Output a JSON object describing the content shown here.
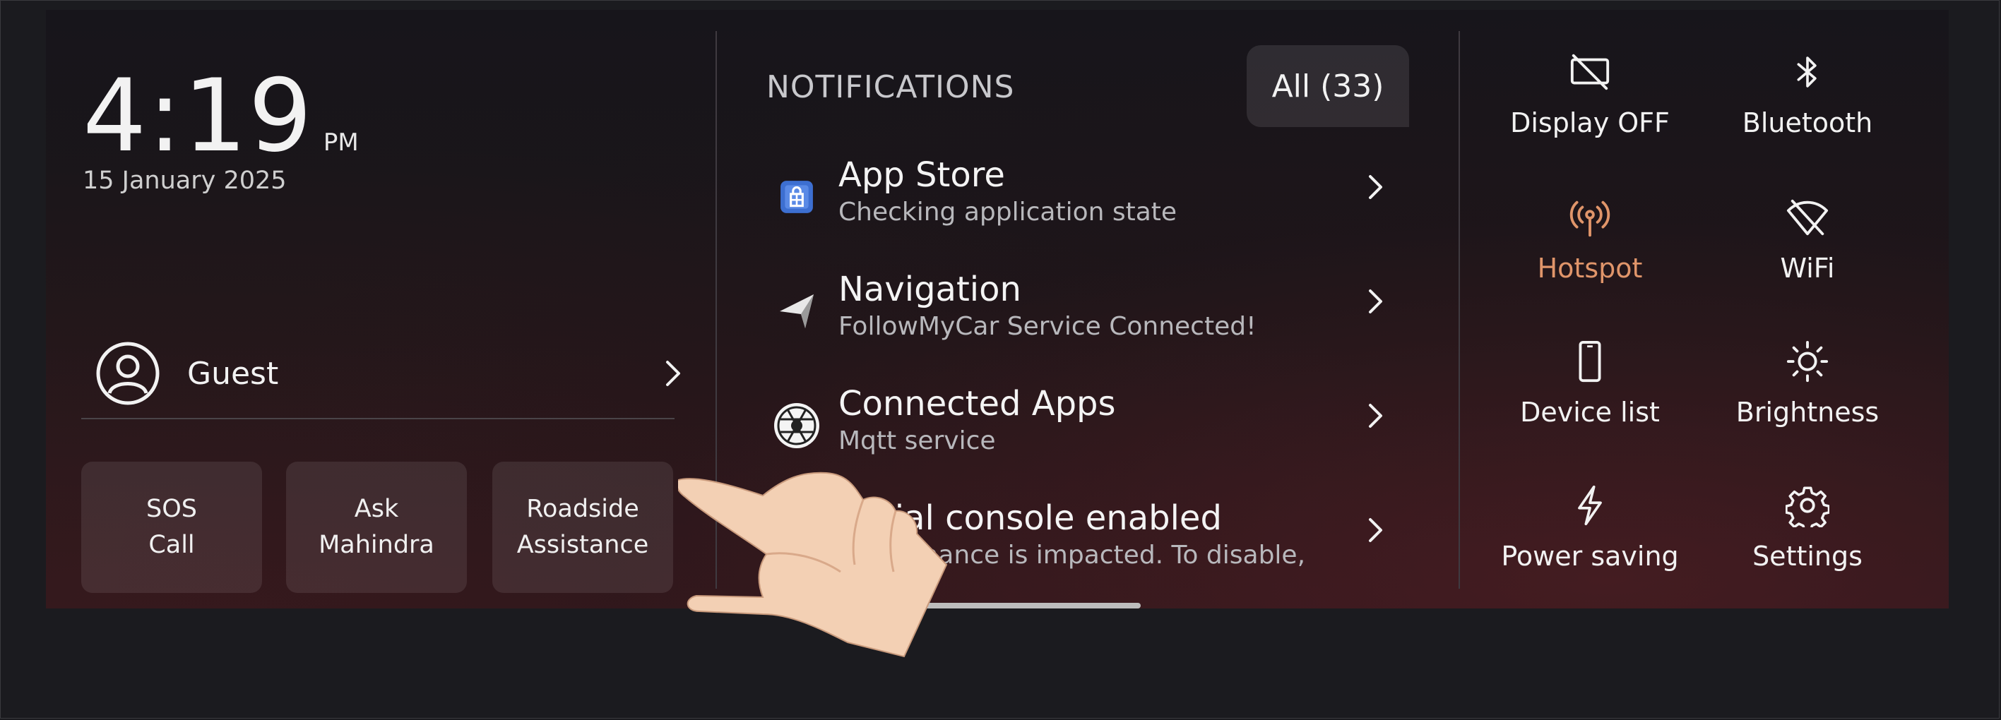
{
  "clock": {
    "time": "4:19",
    "ampm": "PM",
    "date": "15 January 2025"
  },
  "user": {
    "name": "Guest"
  },
  "quick_buttons": [
    {
      "label": "SOS\nCall"
    },
    {
      "label": "Ask\nMahindra"
    },
    {
      "label": "Roadside\nAssistance"
    }
  ],
  "notifications": {
    "title": "NOTIFICATIONS",
    "all_label": "All (33)",
    "items": [
      {
        "title": "App Store",
        "subtitle": "Checking application state",
        "icon": "app-store-icon"
      },
      {
        "title": "Navigation",
        "subtitle": "FollowMyCar Service Connected!",
        "icon": "navigation-arrow-icon"
      },
      {
        "title": "Connected Apps",
        "subtitle": "Mqtt service",
        "icon": "connected-apps-icon"
      },
      {
        "title": "Serial console enabled",
        "subtitle": "Performance is impacted. To disable,",
        "icon": "serial-console-icon"
      }
    ]
  },
  "quick_settings": [
    {
      "label": "Display OFF",
      "icon": "display-off-icon",
      "active": false
    },
    {
      "label": "Bluetooth",
      "icon": "bluetooth-icon",
      "active": false
    },
    {
      "label": "Hotspot",
      "icon": "hotspot-icon",
      "active": true
    },
    {
      "label": "WiFi",
      "icon": "wifi-off-icon",
      "active": false
    },
    {
      "label": "Device list",
      "icon": "phone-icon",
      "active": false
    },
    {
      "label": "Brightness",
      "icon": "brightness-icon",
      "active": false
    },
    {
      "label": "Power saving",
      "icon": "lightning-icon",
      "active": false
    },
    {
      "label": "Settings",
      "icon": "gear-icon",
      "active": false
    }
  ],
  "colors": {
    "accent": "#e0956a",
    "text": "#f2f2f2",
    "muted": "#b8b8bc"
  }
}
